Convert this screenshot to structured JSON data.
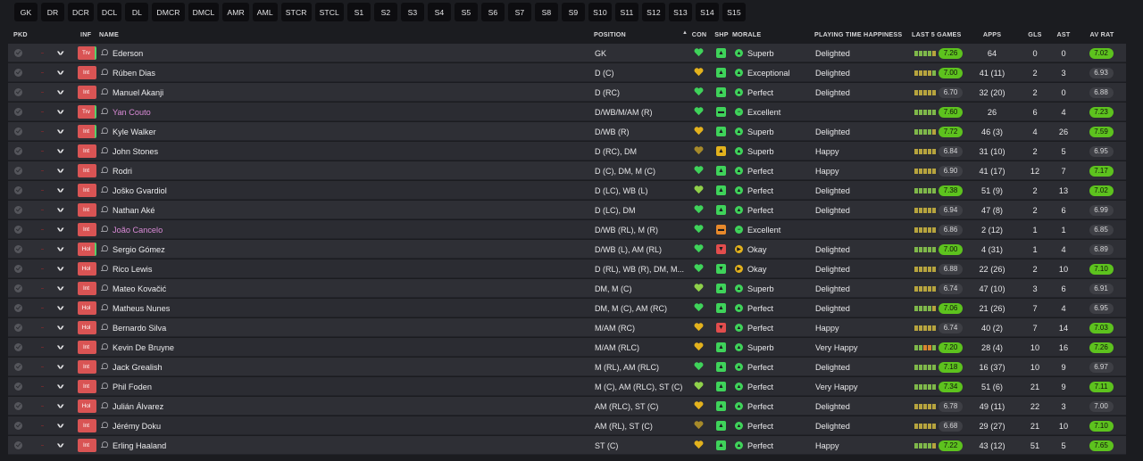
{
  "filters": [
    "GK",
    "DR",
    "DCR",
    "DCL",
    "DL",
    "DMCR",
    "DMCL",
    "AMR",
    "AML",
    "STCR",
    "STCL",
    "S1",
    "S2",
    "S3",
    "S4",
    "S5",
    "S6",
    "S7",
    "S8",
    "S9",
    "S10",
    "S11",
    "S12",
    "S13",
    "S14",
    "S15"
  ],
  "columns": {
    "pkd": "PKD",
    "inf": "INF",
    "name": "NAME",
    "position": "POSITION",
    "con": "CON",
    "shp": "SHP",
    "morale": "MORALE",
    "pth": "PLAYING TIME HAPPINESS",
    "last5": "LAST 5 GAMES",
    "apps": "APPS",
    "gls": "GLS",
    "ast": "AST",
    "avrat": "AV RAT",
    "sort_arrow": "▲"
  },
  "colors": {
    "green_badge": "#5dc21e",
    "grey_badge": "#3e3f45",
    "orange_badge": "#c9a227",
    "heart_green": "#3fd35a",
    "heart_yellow": "#e3b21d",
    "heart_dark_yellow": "#a68a2a",
    "inf_red": "#d95454",
    "loan_pink": "#d98ad6"
  },
  "players": [
    {
      "inf": "Trv",
      "name": "Ederson",
      "loan": false,
      "position": "GK",
      "con": "green",
      "shp": "up-green",
      "morale": "Superb",
      "morale_icon": "up",
      "pth": "Delighted",
      "form": [
        "g",
        "g",
        "g",
        "g",
        "y"
      ],
      "last5": "7.26",
      "last5_style": "green",
      "apps": "64",
      "gls": "0",
      "ast": "0",
      "avrat": "7.02",
      "avrat_style": "green",
      "inf_edge": true
    },
    {
      "inf": "Int",
      "name": "Rúben Dias",
      "loan": false,
      "position": "D (C)",
      "con": "yellow",
      "shp": "up-green",
      "morale": "Exceptional",
      "morale_icon": "up",
      "pth": "Delighted",
      "form": [
        "y",
        "y",
        "y",
        "y",
        "g"
      ],
      "last5": "7.00",
      "last5_style": "green",
      "apps": "41 (11)",
      "gls": "2",
      "ast": "3",
      "avrat": "6.93",
      "avrat_style": "grey",
      "inf_edge": false
    },
    {
      "inf": "Int",
      "name": "Manuel Akanji",
      "loan": false,
      "position": "D (RC)",
      "con": "green",
      "shp": "up-green",
      "morale": "Perfect",
      "morale_icon": "up",
      "pth": "Delighted",
      "form": [
        "y",
        "y",
        "y",
        "y",
        "y"
      ],
      "last5": "6.70",
      "last5_style": "grey",
      "apps": "32 (20)",
      "gls": "2",
      "ast": "0",
      "avrat": "6.88",
      "avrat_style": "grey",
      "inf_edge": false
    },
    {
      "inf": "Trv",
      "name": "Yan Couto",
      "loan": true,
      "position": "D/WB/M/AM (R)",
      "con": "green",
      "shp": "flat-green",
      "morale": "Excellent",
      "morale_icon": "flat",
      "pth": "",
      "form": [
        "g",
        "g",
        "g",
        "g",
        "g"
      ],
      "last5": "7.60",
      "last5_style": "green",
      "apps": "26",
      "gls": "6",
      "ast": "4",
      "avrat": "7.23",
      "avrat_style": "green",
      "inf_edge": true
    },
    {
      "inf": "Int",
      "name": "Kyle Walker",
      "loan": false,
      "position": "D/WB (R)",
      "con": "yellow",
      "shp": "up-green",
      "morale": "Superb",
      "morale_icon": "up",
      "pth": "Delighted",
      "form": [
        "g",
        "g",
        "g",
        "g",
        "y"
      ],
      "last5": "7.72",
      "last5_style": "green",
      "apps": "46 (3)",
      "gls": "4",
      "ast": "26",
      "avrat": "7.59",
      "avrat_style": "green",
      "inf_edge": true
    },
    {
      "inf": "Int",
      "name": "John Stones",
      "loan": false,
      "position": "D (RC), DM",
      "con": "darkyellow",
      "shp": "up-yellow",
      "morale": "Superb",
      "morale_icon": "up",
      "pth": "Happy",
      "form": [
        "y",
        "y",
        "y",
        "y",
        "y"
      ],
      "last5": "6.84",
      "last5_style": "grey",
      "apps": "31 (10)",
      "gls": "2",
      "ast": "5",
      "avrat": "6.95",
      "avrat_style": "grey",
      "inf_edge": false
    },
    {
      "inf": "Int",
      "name": "Rodri",
      "loan": false,
      "position": "D (C), DM, M (C)",
      "con": "green",
      "shp": "up-green",
      "morale": "Perfect",
      "morale_icon": "up",
      "pth": "Happy",
      "form": [
        "y",
        "y",
        "y",
        "y",
        "y"
      ],
      "last5": "6.90",
      "last5_style": "grey",
      "apps": "41 (17)",
      "gls": "12",
      "ast": "7",
      "avrat": "7.17",
      "avrat_style": "green",
      "inf_edge": false
    },
    {
      "inf": "Int",
      "name": "Joško Gvardiol",
      "loan": false,
      "position": "D (LC), WB (L)",
      "con": "lightgreen",
      "shp": "up-green",
      "morale": "Perfect",
      "morale_icon": "up",
      "pth": "Delighted",
      "form": [
        "g",
        "g",
        "g",
        "g",
        "g"
      ],
      "last5": "7.38",
      "last5_style": "green",
      "apps": "51 (9)",
      "gls": "2",
      "ast": "13",
      "avrat": "7.02",
      "avrat_style": "green",
      "inf_edge": false
    },
    {
      "inf": "Int",
      "name": "Nathan Aké",
      "loan": false,
      "position": "D (LC), DM",
      "con": "green",
      "shp": "up-green",
      "morale": "Perfect",
      "morale_icon": "up",
      "pth": "Delighted",
      "form": [
        "y",
        "y",
        "y",
        "y",
        "y"
      ],
      "last5": "6.94",
      "last5_style": "grey",
      "apps": "47 (8)",
      "gls": "2",
      "ast": "6",
      "avrat": "6.99",
      "avrat_style": "grey",
      "inf_edge": false
    },
    {
      "inf": "Int",
      "name": "João Cancelo",
      "loan": true,
      "position": "D/WB (RL), M (R)",
      "con": "green",
      "shp": "flat-orange",
      "morale": "Excellent",
      "morale_icon": "flat",
      "pth": "",
      "form": [
        "y",
        "y",
        "y",
        "y",
        "y"
      ],
      "last5": "6.86",
      "last5_style": "grey",
      "apps": "2 (12)",
      "gls": "1",
      "ast": "1",
      "avrat": "6.85",
      "avrat_style": "grey",
      "inf_edge": false
    },
    {
      "inf": "Hol",
      "name": "Sergio Gómez",
      "loan": false,
      "position": "D/WB (L), AM (RL)",
      "con": "green",
      "shp": "down-red",
      "morale": "Okay",
      "morale_icon": "right",
      "pth": "Delighted",
      "form": [
        "g",
        "g",
        "g",
        "g",
        "g"
      ],
      "last5": "7.00",
      "last5_style": "green",
      "apps": "4 (31)",
      "gls": "1",
      "ast": "4",
      "avrat": "6.89",
      "avrat_style": "grey",
      "inf_edge": true
    },
    {
      "inf": "Hol",
      "name": "Rico Lewis",
      "loan": false,
      "position": "D (RL), WB (R), DM, M...",
      "con": "green",
      "shp": "down-green",
      "morale": "Okay",
      "morale_icon": "right",
      "pth": "Delighted",
      "form": [
        "y",
        "y",
        "y",
        "y",
        "y"
      ],
      "last5": "6.88",
      "last5_style": "grey",
      "apps": "22 (26)",
      "gls": "2",
      "ast": "10",
      "avrat": "7.10",
      "avrat_style": "green",
      "inf_edge": false
    },
    {
      "inf": "Int",
      "name": "Mateo Kovačić",
      "loan": false,
      "position": "DM, M (C)",
      "con": "lightgreen",
      "shp": "up-green",
      "morale": "Superb",
      "morale_icon": "up",
      "pth": "Delighted",
      "form": [
        "y",
        "y",
        "y",
        "y",
        "y"
      ],
      "last5": "6.74",
      "last5_style": "grey",
      "apps": "47 (10)",
      "gls": "3",
      "ast": "6",
      "avrat": "6.91",
      "avrat_style": "grey",
      "inf_edge": false
    },
    {
      "inf": "Hol",
      "name": "Matheus Nunes",
      "loan": false,
      "position": "DM, M (C), AM (RC)",
      "con": "green",
      "shp": "up-green",
      "morale": "Perfect",
      "morale_icon": "up",
      "pth": "Delighted",
      "form": [
        "g",
        "g",
        "g",
        "g",
        "y"
      ],
      "last5": "7.06",
      "last5_style": "green",
      "apps": "21 (26)",
      "gls": "7",
      "ast": "4",
      "avrat": "6.95",
      "avrat_style": "grey",
      "inf_edge": false
    },
    {
      "inf": "Hol",
      "name": "Bernardo Silva",
      "loan": false,
      "position": "M/AM (RC)",
      "con": "yellow",
      "shp": "down-red",
      "morale": "Perfect",
      "morale_icon": "up",
      "pth": "Happy",
      "form": [
        "y",
        "y",
        "y",
        "y",
        "y"
      ],
      "last5": "6.74",
      "last5_style": "grey",
      "apps": "40 (2)",
      "gls": "7",
      "ast": "14",
      "avrat": "7.03",
      "avrat_style": "green",
      "inf_edge": false
    },
    {
      "inf": "Int",
      "name": "Kevin De Bruyne",
      "loan": false,
      "position": "M/AM (RLC)",
      "con": "yellow",
      "shp": "up-green",
      "morale": "Superb",
      "morale_icon": "up",
      "pth": "Very Happy",
      "form": [
        "g",
        "g",
        "o",
        "o",
        "g"
      ],
      "last5": "7.20",
      "last5_style": "green",
      "apps": "28 (4)",
      "gls": "10",
      "ast": "16",
      "avrat": "7.26",
      "avrat_style": "green",
      "inf_edge": false
    },
    {
      "inf": "Int",
      "name": "Jack Grealish",
      "loan": false,
      "position": "M (RL), AM (RLC)",
      "con": "green",
      "shp": "up-green",
      "morale": "Perfect",
      "morale_icon": "up",
      "pth": "Delighted",
      "form": [
        "g",
        "g",
        "g",
        "g",
        "g"
      ],
      "last5": "7.18",
      "last5_style": "green",
      "apps": "16 (37)",
      "gls": "10",
      "ast": "9",
      "avrat": "6.97",
      "avrat_style": "grey",
      "inf_edge": false
    },
    {
      "inf": "Int",
      "name": "Phil Foden",
      "loan": false,
      "position": "M (C), AM (RLC), ST (C)",
      "con": "lightgreen",
      "shp": "up-green",
      "morale": "Perfect",
      "morale_icon": "up",
      "pth": "Very Happy",
      "form": [
        "g",
        "g",
        "g",
        "g",
        "g"
      ],
      "last5": "7.34",
      "last5_style": "green",
      "apps": "51 (6)",
      "gls": "21",
      "ast": "9",
      "avrat": "7.11",
      "avrat_style": "green",
      "inf_edge": false
    },
    {
      "inf": "Hol",
      "name": "Julián Álvarez",
      "loan": false,
      "position": "AM (RLC), ST (C)",
      "con": "yellow",
      "shp": "up-green",
      "morale": "Perfect",
      "morale_icon": "up",
      "pth": "Delighted",
      "form": [
        "y",
        "y",
        "y",
        "y",
        "y"
      ],
      "last5": "6.78",
      "last5_style": "grey",
      "apps": "49 (11)",
      "gls": "22",
      "ast": "3",
      "avrat": "7.00",
      "avrat_style": "grey",
      "inf_edge": false
    },
    {
      "inf": "Int",
      "name": "Jérémy Doku",
      "loan": false,
      "position": "AM (RL), ST (C)",
      "con": "darkyellow",
      "shp": "up-green",
      "morale": "Perfect",
      "morale_icon": "up",
      "pth": "Delighted",
      "form": [
        "y",
        "y",
        "y",
        "y",
        "y"
      ],
      "last5": "6.68",
      "last5_style": "grey",
      "apps": "29 (27)",
      "gls": "21",
      "ast": "10",
      "avrat": "7.10",
      "avrat_style": "green",
      "inf_edge": false
    },
    {
      "inf": "Int",
      "name": "Erling Haaland",
      "loan": false,
      "position": "ST (C)",
      "con": "yellow",
      "shp": "up-green",
      "morale": "Perfect",
      "morale_icon": "up",
      "pth": "Happy",
      "form": [
        "g",
        "g",
        "g",
        "g",
        "y"
      ],
      "last5": "7.22",
      "last5_style": "green",
      "apps": "43 (12)",
      "gls": "51",
      "ast": "5",
      "avrat": "7.65",
      "avrat_style": "green",
      "inf_edge": false
    }
  ]
}
